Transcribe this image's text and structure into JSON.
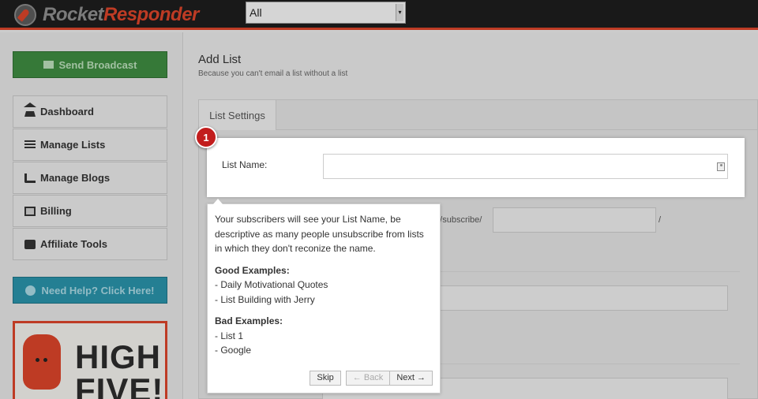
{
  "header": {
    "logo_part1": "Rocket",
    "logo_part2": "Responder",
    "selector_value": "All"
  },
  "sidebar": {
    "broadcast_label": "Send Broadcast",
    "items": [
      {
        "label": "Dashboard",
        "icon": "home-icon"
      },
      {
        "label": "Manage Lists",
        "icon": "list-icon"
      },
      {
        "label": "Manage Blogs",
        "icon": "rss-icon"
      },
      {
        "label": "Billing",
        "icon": "money-icon"
      },
      {
        "label": "Affiliate Tools",
        "icon": "briefcase-icon"
      }
    ],
    "help_label": "Need Help? Click Here!",
    "banner_text": "HIGH FIVE!"
  },
  "main": {
    "title": "Add List",
    "subtitle": "Because you can't email a list without a list",
    "tab_label": "List Settings",
    "list_name_label": "List Name:",
    "list_name_value": "",
    "url_fragment": "m/subscribe/",
    "url_suffix": "/"
  },
  "tour": {
    "step_number": "1",
    "intro": "Your subscribers will see your List Name, be descriptive as many people unsubscribe from lists in which they don't reconize the name.",
    "good_heading": "Good Examples:",
    "good_examples": [
      "- Daily Motivational Quotes",
      "- List Building with Jerry"
    ],
    "bad_heading": "Bad Examples:",
    "bad_examples": [
      "- List 1",
      "- Google"
    ],
    "skip_label": "Skip",
    "back_label": "← Back",
    "next_label": "Next →"
  },
  "colors": {
    "brand_red": "#d9442a",
    "broadcast_green": "#3e8a40",
    "help_teal": "#2a91a8",
    "badge_red": "#c21d1d"
  }
}
